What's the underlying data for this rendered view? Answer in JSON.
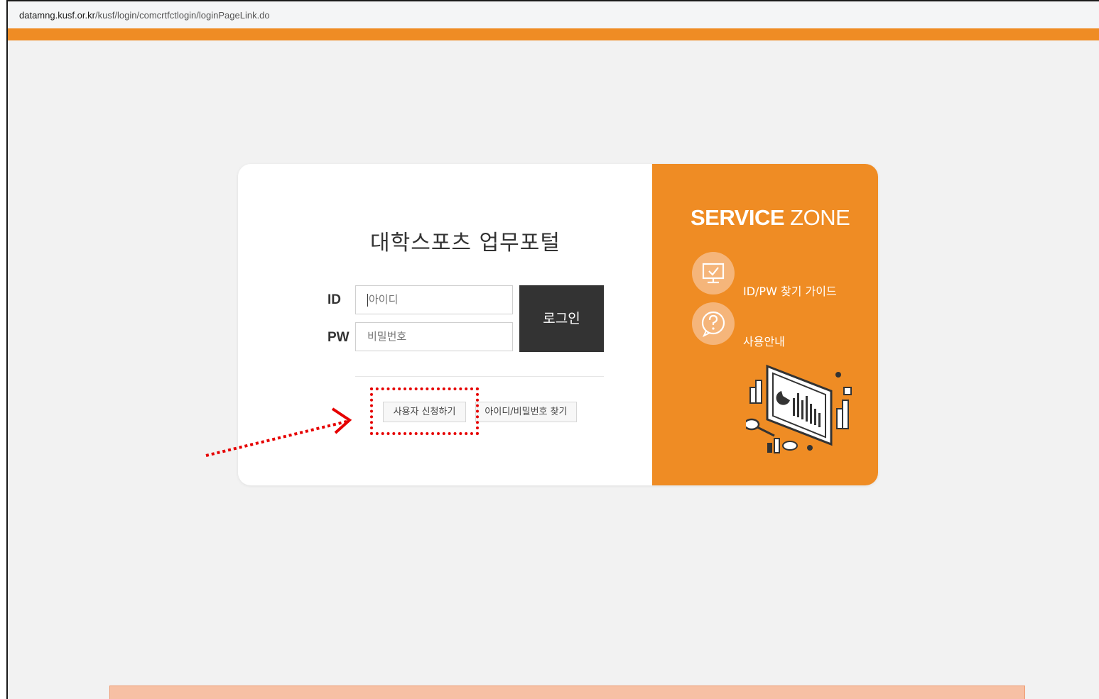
{
  "browser": {
    "url_host": "datamng.kusf.or.kr",
    "url_path": "/kusf/login/comcrtfctlogin/loginPageLink.do"
  },
  "login": {
    "title": "대학스포츠 업무포털",
    "id_label": "ID",
    "pw_label": "PW",
    "id_placeholder": "아이디",
    "pw_placeholder": "비밀번호",
    "login_button": "로그인",
    "signup_button": "사용자 신청하기",
    "find_button": "아이디/비밀번호 찾기"
  },
  "service_zone": {
    "title_bold": "SERVICE",
    "title_light": " ZONE",
    "items": [
      {
        "label": "ID/PW 찾기 가이드",
        "icon": "monitor-check-icon"
      },
      {
        "label": "사용안내",
        "icon": "question-icon"
      }
    ]
  },
  "colors": {
    "brand_orange": "#ef8c24",
    "dark_button": "#333333",
    "annotation_red": "#e60000"
  }
}
